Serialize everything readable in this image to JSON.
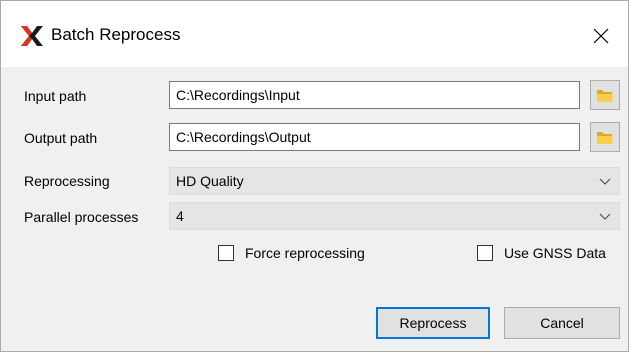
{
  "window": {
    "title": "Batch Reprocess",
    "accent_color": "#1a1a1a",
    "logo_icon": "x-logo-icon",
    "close_icon": "close-icon"
  },
  "form": {
    "input_path": {
      "label": "Input path",
      "value": "C:\\Recordings\\Input",
      "browse_icon": "folder-icon"
    },
    "output_path": {
      "label": "Output path",
      "value": "C:\\Recordings\\Output",
      "browse_icon": "folder-icon"
    },
    "reprocessing": {
      "label": "Reprocessing",
      "value": "HD Quality"
    },
    "parallel": {
      "label": "Parallel processes",
      "value": "4"
    },
    "force_reprocessing": {
      "label": "Force reprocessing",
      "checked": false
    },
    "use_gnss": {
      "label": "Use GNSS Data",
      "checked": false
    }
  },
  "buttons": {
    "reprocess": "Reprocess",
    "cancel": "Cancel"
  }
}
